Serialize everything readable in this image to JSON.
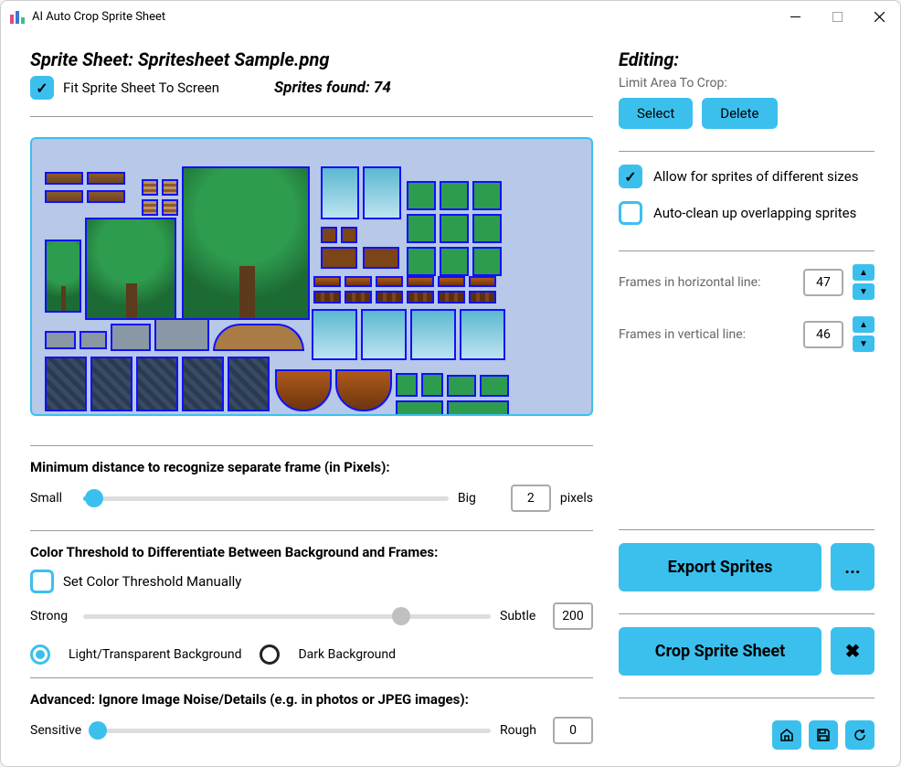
{
  "window": {
    "title": "AI Auto Crop Sprite Sheet"
  },
  "sheet": {
    "heading": "Sprite Sheet: Spritesheet Sample.png",
    "fit_label": "Fit Sprite Sheet To Screen",
    "fit_checked": true,
    "count_label": "Sprites found: 74"
  },
  "distance": {
    "title": "Minimum distance to recognize separate frame (in Pixels):",
    "min_label": "Small",
    "max_label": "Big",
    "value": "2",
    "unit": "pixels"
  },
  "threshold": {
    "title": "Color Threshold to Differentiate Between Background and Frames:",
    "manual_label": "Set Color Threshold Manually",
    "manual_checked": false,
    "min_label": "Strong",
    "max_label": "Subtle",
    "value": "200",
    "radio_light": "Light/Transparent Background",
    "radio_dark": "Dark Background"
  },
  "noise": {
    "title": "Advanced: Ignore Image Noise/Details (e.g. in photos or JPEG images):",
    "min_label": "Sensitive",
    "max_label": "Rough",
    "value": "0"
  },
  "editing": {
    "heading": "Editing:",
    "limit_label": "Limit Area To Crop:",
    "select_btn": "Select",
    "delete_btn": "Delete",
    "allow_diff_label": "Allow for sprites of different sizes",
    "allow_diff_checked": true,
    "autoclean_label": "Auto-clean up overlapping sprites",
    "autoclean_checked": false,
    "frames_h_label": "Frames in horizontal line:",
    "frames_h_value": "47",
    "frames_v_label": "Frames in vertical line:",
    "frames_v_value": "46"
  },
  "actions": {
    "export_btn": "Export Sprites",
    "export_more": "...",
    "crop_btn": "Crop Sprite Sheet",
    "crop_cancel": "✖"
  }
}
